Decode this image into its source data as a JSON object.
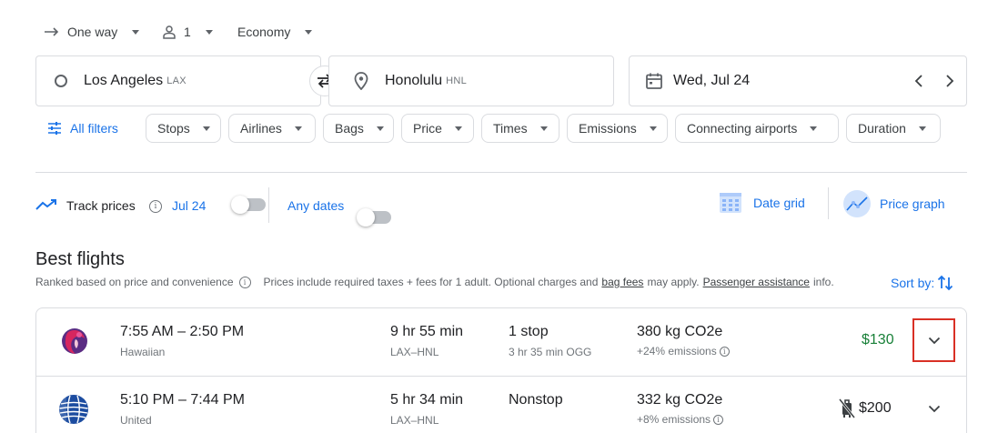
{
  "trip": {
    "trip_type": "One way",
    "passengers": "1",
    "cabin": "Economy"
  },
  "search": {
    "origin_city": "Los Angeles",
    "origin_code": "LAX",
    "destination_city": "Honolulu",
    "destination_code": "HNL",
    "date": "Wed, Jul 24"
  },
  "filters": {
    "all_filters": "All filters",
    "chips": [
      "Stops",
      "Airlines",
      "Bags",
      "Price",
      "Times",
      "Emissions",
      "Connecting airports",
      "Duration"
    ]
  },
  "tracking": {
    "track_prices": "Track prices",
    "track_date": "Jul 24",
    "any_dates": "Any dates",
    "date_grid": "Date grid",
    "price_graph": "Price graph"
  },
  "results": {
    "heading": "Best flights",
    "ranked_text": "Ranked based on price and convenience",
    "disclaimer_pre": "Prices include required taxes + fees for 1 adult. Optional charges and",
    "bag_fees": "bag fees",
    "disclaimer_mid": "may apply.",
    "passenger_assistance": "Passenger assistance",
    "disclaimer_post": "info.",
    "sort_by": "Sort by:"
  },
  "flights": [
    {
      "times": "7:55 AM – 2:50 PM",
      "airline": "Hawaiian",
      "duration": "9 hr 55 min",
      "route": "LAX–HNL",
      "stops": "1 stop",
      "layover": "3 hr 35 min OGG",
      "emissions": "380 kg CO2e",
      "emissions_delta": "+24% emissions",
      "price": "$130",
      "price_color": "#188038"
    },
    {
      "times": "5:10 PM – 7:44 PM",
      "airline": "United",
      "duration": "5 hr 34 min",
      "route": "LAX–HNL",
      "stops": "Nonstop",
      "layover": "",
      "emissions": "332 kg CO2e",
      "emissions_delta": "+8% emissions",
      "price": "$200",
      "price_color": "#202124"
    }
  ],
  "colors": {
    "accent": "#1a73e8",
    "good_price": "#188038",
    "highlight_border": "#d93025",
    "border": "#dadce0"
  }
}
